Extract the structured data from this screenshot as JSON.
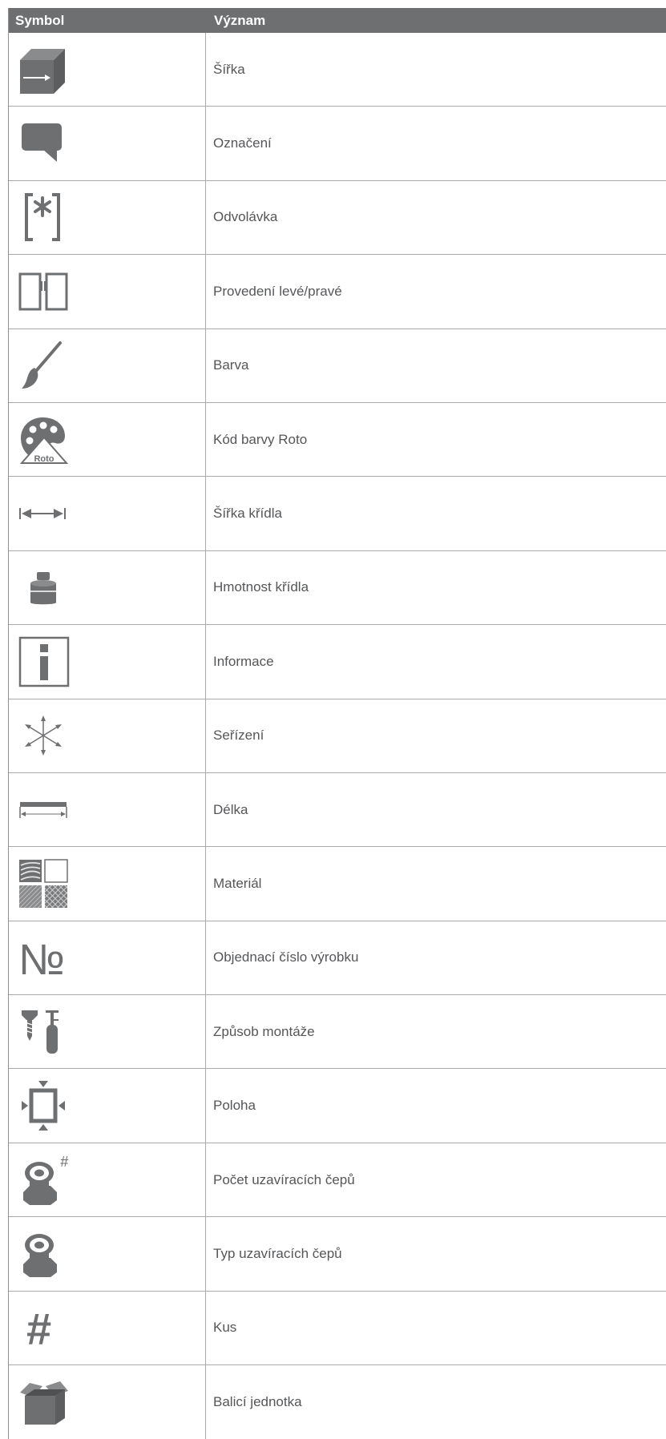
{
  "header": {
    "symbol": "Symbol",
    "meaning": "Význam"
  },
  "rows": [
    {
      "icon": "box-width-icon",
      "label": "Šířka"
    },
    {
      "icon": "speech-bubble-icon",
      "label": "Označení"
    },
    {
      "icon": "bracket-asterisk-icon",
      "label": "Odvolávka"
    },
    {
      "icon": "left-right-sash-icon",
      "label": "Provedení levé/pravé"
    },
    {
      "icon": "paint-brush-icon",
      "label": "Barva"
    },
    {
      "icon": "palette-roto-icon",
      "label": "Kód barvy Roto",
      "badge": "Roto"
    },
    {
      "icon": "width-arrow-icon",
      "label": "Šířka křídla"
    },
    {
      "icon": "weight-icon",
      "label": "Hmotnost křídla"
    },
    {
      "icon": "info-icon",
      "label": "Informace"
    },
    {
      "icon": "adjust-arrows-icon",
      "label": "Seřízení"
    },
    {
      "icon": "length-bar-icon",
      "label": "Délka"
    },
    {
      "icon": "material-swatches-icon",
      "label": "Materiál"
    },
    {
      "icon": "number-sign-icon",
      "label": "Objednací číslo výrobku",
      "glyph": "№"
    },
    {
      "icon": "screw-mount-icon",
      "label": "Způsob montáže"
    },
    {
      "icon": "position-icon",
      "label": "Poloha"
    },
    {
      "icon": "locking-cam-count-icon",
      "label": "Počet uzavíracích čepů",
      "glyph": "#"
    },
    {
      "icon": "locking-cam-icon",
      "label": "Typ uzavíracích čepů"
    },
    {
      "icon": "hash-icon",
      "label": "Kus",
      "glyph": "#"
    },
    {
      "icon": "package-icon",
      "label": "Balicí jednotka"
    }
  ],
  "colors": {
    "header_bg": "#6e6f71",
    "icon": "#6e6f71",
    "text": "#555658",
    "rule": "#a9aaac"
  }
}
